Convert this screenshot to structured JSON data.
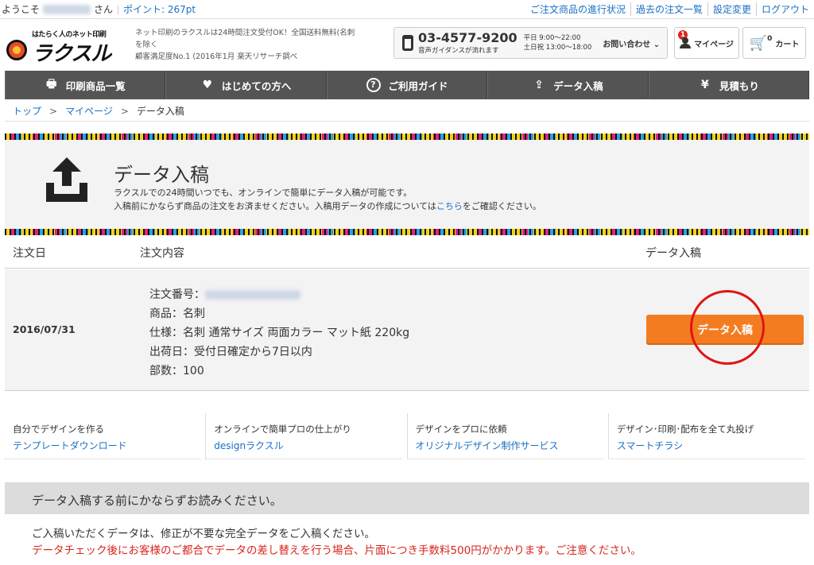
{
  "topbar": {
    "welcome": "ようこそ",
    "suffix": "さん",
    "points": "ポイント: 267pt",
    "links": [
      "ご注文商品の進行状況",
      "過去の注文一覧",
      "設定変更",
      "ログアウト"
    ]
  },
  "header": {
    "logo_tag": "はたらく人のネット印刷",
    "logo_word": "ラクスル",
    "tagline": [
      "ネット印刷のラクスルは24時間注文受付OK！全国送料無料(名刺",
      "を除く",
      "顧客満足度No.1 (2016年1月 楽天リサーチ調べ"
    ],
    "phone": "03-4577-9200",
    "phone_guide": "音声ガイダンスが流れます",
    "hours_weekday": "平日 9:00〜22:00",
    "hours_weekend": "土日祝 13:00〜18:00",
    "inquiry": "お問い合わせ",
    "mypage": "マイページ",
    "mypage_badge": "1",
    "cart": "カート",
    "cart_count": "0"
  },
  "nav": [
    {
      "label": "印刷商品一覧",
      "icon": "printer-icon",
      "glyph": "🖶"
    },
    {
      "label": "はじめての方へ",
      "icon": "heart-icon",
      "glyph": "♥"
    },
    {
      "label": "ご利用ガイド",
      "icon": "question-icon",
      "glyph": "?"
    },
    {
      "label": "データ入稿",
      "icon": "upload-icon",
      "glyph": "⇪"
    },
    {
      "label": "見積もり",
      "icon": "yen-icon",
      "glyph": "¥"
    }
  ],
  "breadcrumb": {
    "top": "トップ",
    "mypage": "マイページ",
    "current": "データ入稿"
  },
  "page": {
    "title": "データ入稿",
    "desc1": "ラクスルでの24時間いつでも、オンラインで簡単にデータ入稿が可能です。",
    "desc2_pre": "入稿前にかならず商品の注文をお済ませください。入稿用データの作成については",
    "desc2_link": "こちら",
    "desc2_post": "をご確認ください。"
  },
  "table": {
    "headers": {
      "date": "注文日",
      "content": "注文内容",
      "upload": "データ入稿"
    },
    "row": {
      "date": "2016/07/31",
      "order_label": "注文番号：",
      "product": "商品：名刺",
      "spec": "仕様：名刺 通常サイズ 両面カラー マット紙 220kg",
      "ship": "出荷日：受付日確定から7日以内",
      "qty": "部数：100",
      "button": "データ入稿"
    }
  },
  "links": [
    {
      "title": "自分でデザインを作る",
      "link": "テンプレートダウンロード"
    },
    {
      "title": "オンラインで簡単プロの仕上がり",
      "link": "designラクスル"
    },
    {
      "title": "デザインをプロに依頼",
      "link": "オリジナルデザイン制作サービス"
    },
    {
      "title": "デザイン･印刷･配布を全て丸投げ",
      "link": "スマートチラシ"
    }
  ],
  "notice": {
    "heading": "データ入稿する前にかならずお読みください。",
    "line1": "ご入稿いただくデータは、修正が不要な完全データをご入稿ください。",
    "line2": "データチェック後にお客様のご都合でデータの差し替えを行う場合、片面につき手数料500円がかかります。ご注意ください。"
  }
}
